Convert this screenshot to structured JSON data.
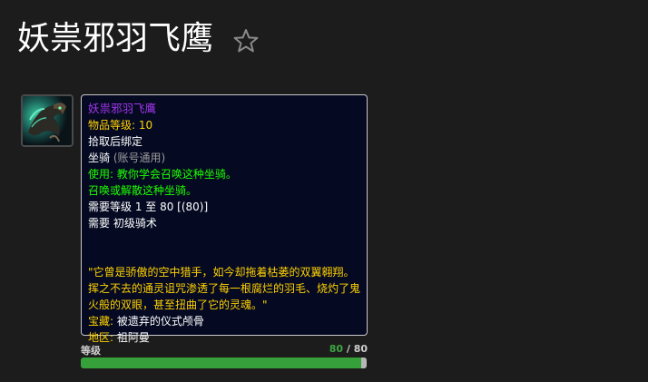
{
  "page": {
    "title": "妖祟邪羽飞鹰",
    "favorite_icon": "star-outline-icon"
  },
  "item": {
    "icon": "nightmare-bird-mount-icon",
    "name": "妖祟邪羽飞鹰",
    "item_level_label": "物品等级:",
    "item_level": "10",
    "binding": "拾取后绑定",
    "type": "坐骑",
    "type_note": "(账号通用)",
    "use_text": "使用: 教你学会召唤这种坐骑。",
    "summon_text": "召唤或解散这种坐骑。",
    "req_level": "需要等级 1 至 80 [(80)]",
    "req_skill": "需要 初级骑术",
    "flavor": "\"它曾是骄傲的空中猎手，如今却拖着枯萎的双翼翱翔。挥之不去的通灵诅咒渗透了每一根腐烂的羽毛、烧灼了鬼火般的双眼，甚至扭曲了它的灵魂。\"",
    "cache_label": "宝藏:",
    "cache_value": "被遗弃的仪式颅骨",
    "zone_label": "地区:",
    "zone_value": "祖阿曼",
    "colors": {
      "epic_name": "#a335ee",
      "gold": "#ffd100",
      "green": "#1eff00",
      "tooltip_bg": "#050a22"
    }
  },
  "level": {
    "label": "等级",
    "current": "80",
    "separator": " / ",
    "max": "80",
    "fraction": 1.0,
    "bar_color": "#36a03a"
  }
}
